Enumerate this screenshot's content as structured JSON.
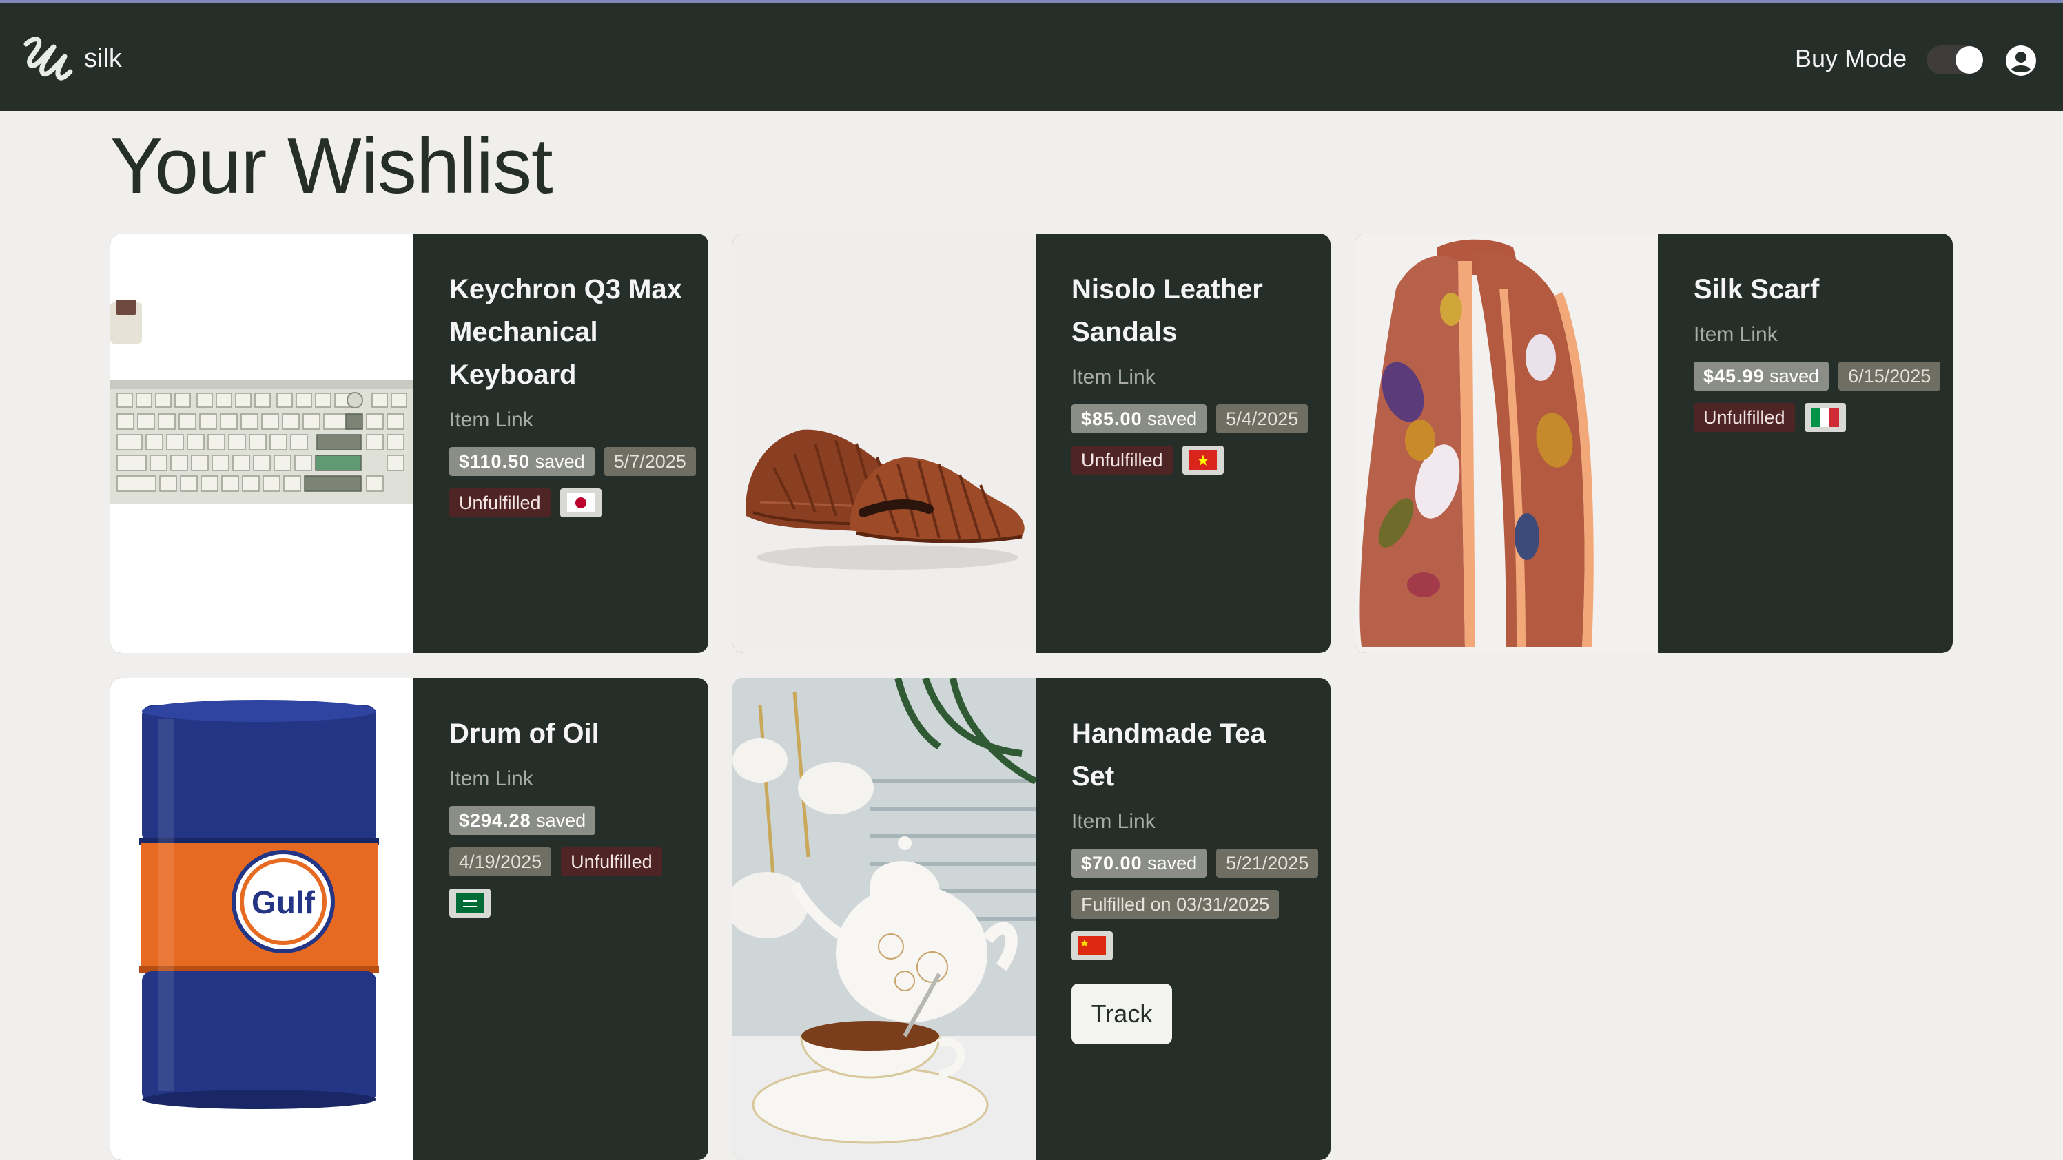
{
  "app": {
    "brand": "silk"
  },
  "header": {
    "buy_mode_label": "Buy Mode",
    "buy_mode_on": true
  },
  "page": {
    "title": "Your Wishlist"
  },
  "colors": {
    "navbar": "#262e2a",
    "background": "#f0efed",
    "saved_badge": "#8b8e86",
    "unfulfilled_badge": "#4e2424",
    "date_badge": "#6f6e62"
  },
  "items": [
    {
      "name": "Keychron Q3 Max Mechanical Keyboard",
      "link": "Item Link",
      "saved_amount": "$110.50",
      "saved_suffix": "saved",
      "date": "5/7/2025",
      "status": "Unfulfilled",
      "flag": "japan-flag-icon"
    },
    {
      "name": "Nisolo Leather Sandals",
      "link": "Item Link",
      "saved_amount": "$85.00",
      "saved_suffix": "saved",
      "date": "5/4/2025",
      "status": "Unfulfilled",
      "flag": "vietnam-flag-icon"
    },
    {
      "name": "Silk Scarf",
      "link": "Item Link",
      "saved_amount": "$45.99",
      "saved_suffix": "saved",
      "date": "6/15/2025",
      "status": "Unfulfilled",
      "flag": "italy-flag-icon"
    },
    {
      "name": "Drum of Oil",
      "link": "Item Link",
      "saved_amount": "$294.28",
      "saved_suffix": "saved",
      "date": "4/19/2025",
      "status": "Unfulfilled",
      "flag": "saudi-arabia-flag-icon",
      "image_label": "Gulf"
    },
    {
      "name": "Handmade Tea Set",
      "link": "Item Link",
      "saved_amount": "$70.00",
      "saved_suffix": "saved",
      "date": "5/21/2025",
      "status": "Fulfilled on 03/31/2025",
      "flag": "china-flag-icon",
      "action": "Track"
    }
  ]
}
